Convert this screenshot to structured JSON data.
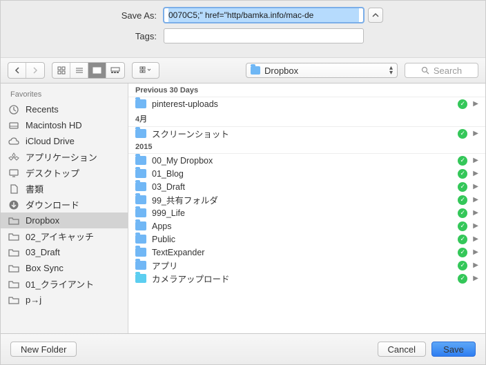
{
  "form": {
    "saveAsLabel": "Save As:",
    "saveAsValue": "0070C5;\" href=\"http/bamka.info/mac-de",
    "tagsLabel": "Tags:",
    "tagsValue": ""
  },
  "toolbar": {
    "location": "Dropbox",
    "searchPlaceholder": "Search"
  },
  "sidebar": {
    "header": "Favorites",
    "items": [
      {
        "icon": "recents",
        "label": "Recents",
        "sel": false
      },
      {
        "icon": "hd",
        "label": "Macintosh HD",
        "sel": false
      },
      {
        "icon": "cloud",
        "label": "iCloud Drive",
        "sel": false
      },
      {
        "icon": "apps",
        "label": "アプリケーション",
        "sel": false
      },
      {
        "icon": "desktop",
        "label": "デスクトップ",
        "sel": false
      },
      {
        "icon": "docs",
        "label": "書類",
        "sel": false
      },
      {
        "icon": "downloads",
        "label": "ダウンロード",
        "sel": false
      },
      {
        "icon": "folder",
        "label": "Dropbox",
        "sel": true
      },
      {
        "icon": "folder",
        "label": "02_アイキャッチ",
        "sel": false
      },
      {
        "icon": "folder",
        "label": "03_Draft",
        "sel": false
      },
      {
        "icon": "folder",
        "label": "Box Sync",
        "sel": false
      },
      {
        "icon": "folder",
        "label": "01_クライアント",
        "sel": false
      },
      {
        "icon": "folder",
        "label": "p→j",
        "sel": false
      }
    ]
  },
  "files": {
    "groups": [
      {
        "header": "Previous 30 Days",
        "items": [
          {
            "icon": "blue",
            "name": "pinterest-uploads"
          }
        ]
      },
      {
        "header": "4月",
        "items": [
          {
            "icon": "blue",
            "name": "スクリーンショット"
          }
        ]
      },
      {
        "header": "2015",
        "items": [
          {
            "icon": "blue",
            "name": "00_My Dropbox"
          },
          {
            "icon": "blue",
            "name": "01_Blog"
          },
          {
            "icon": "blue",
            "name": "03_Draft"
          },
          {
            "icon": "blue",
            "name": "99_共有フォルダ"
          },
          {
            "icon": "blue",
            "name": "999_Life"
          },
          {
            "icon": "blue",
            "name": "Apps"
          },
          {
            "icon": "blue",
            "name": "Public"
          },
          {
            "icon": "blue",
            "name": "TextExpander"
          },
          {
            "icon": "blue",
            "name": "アプリ"
          },
          {
            "icon": "aqua",
            "name": "カメラアップロード"
          }
        ]
      }
    ]
  },
  "footer": {
    "newFolder": "New Folder",
    "cancel": "Cancel",
    "save": "Save"
  }
}
